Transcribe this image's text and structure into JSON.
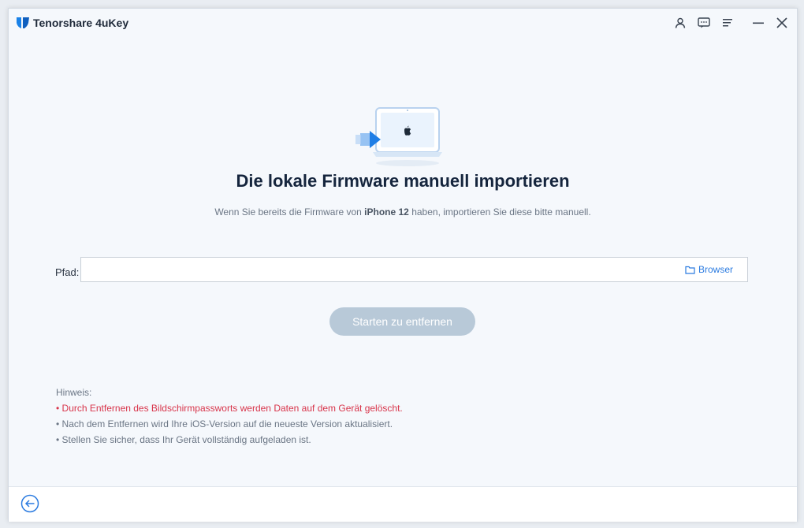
{
  "app": {
    "title": "Tenorshare 4uKey"
  },
  "titlebar": {
    "icons": [
      "user-icon",
      "feedback-icon",
      "menu-icon",
      "minimize-icon",
      "close-icon"
    ]
  },
  "main": {
    "headline": "Die lokale Firmware manuell importieren",
    "subtitle_pre": "Wenn Sie bereits die Firmware von ",
    "subtitle_device": "iPhone 12",
    "subtitle_post": " haben, importieren Sie diese bitte manuell.",
    "path_label": "Pfad:",
    "path_value": "",
    "browse_label": "Browser",
    "start_button_label": "Starten zu entfernen"
  },
  "notes": {
    "heading": "Hinweis:",
    "items": [
      "• Durch Entfernen des Bildschirmpassworts werden Daten auf dem Gerät gelöscht.",
      "• Nach dem Entfernen wird Ihre iOS-Version auf die neueste Version aktualisiert.",
      "• Stellen Sie sicher, dass Ihr Gerät vollständig aufgeladen ist."
    ]
  },
  "colors": {
    "accent": "#2b7be0",
    "warning": "#d8344a",
    "button_disabled": "#b8c9d8",
    "background": "#f5f8fc"
  },
  "footer": {
    "back_icon": "back-arrow-icon"
  }
}
